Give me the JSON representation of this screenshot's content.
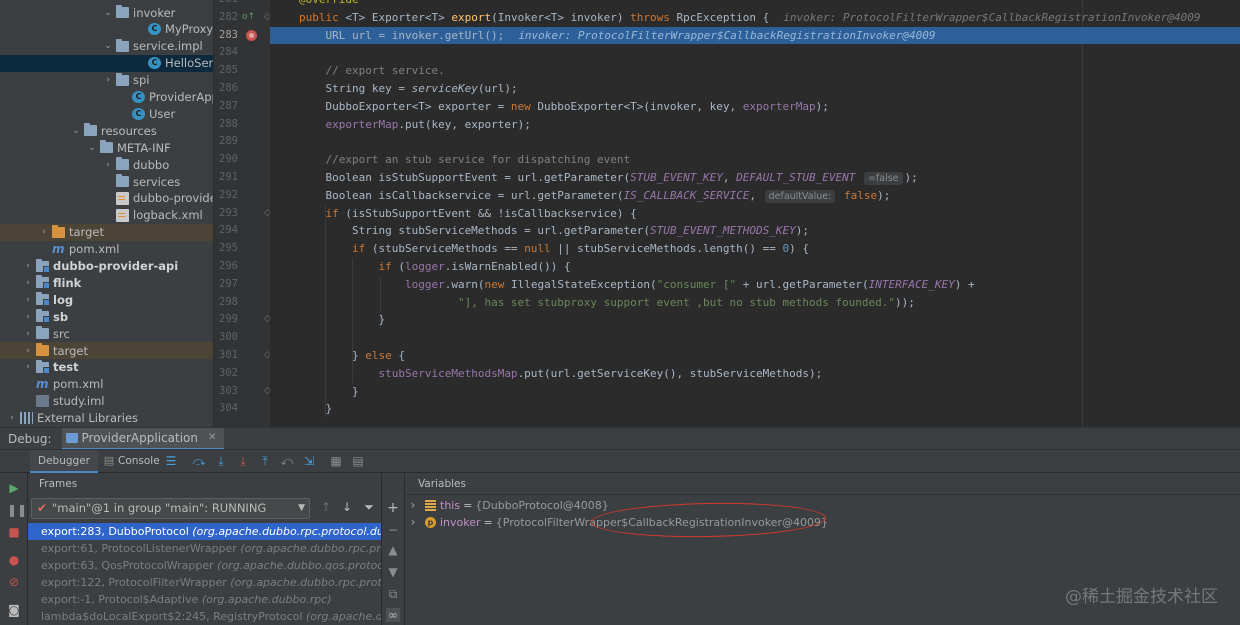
{
  "project_tree": [
    {
      "label": "invoker",
      "icon": "folder",
      "indent": 102,
      "arrow": "▾"
    },
    {
      "label": "MyProxyInvo",
      "icon": "class",
      "indent": 134,
      "arrow": ""
    },
    {
      "label": "service.impl",
      "icon": "folder",
      "indent": 102,
      "arrow": "▾"
    },
    {
      "label": "HelloServiceI",
      "icon": "class",
      "indent": 134,
      "arrow": "",
      "selected": true
    },
    {
      "label": "spi",
      "icon": "folder",
      "indent": 102,
      "arrow": "▸"
    },
    {
      "label": "ProviderApplicat",
      "icon": "class",
      "indent": 118,
      "arrow": ""
    },
    {
      "label": "User",
      "icon": "class",
      "indent": 118,
      "arrow": ""
    },
    {
      "label": "resources",
      "icon": "folder-res",
      "indent": 70,
      "arrow": "▾"
    },
    {
      "label": "META-INF",
      "icon": "folder",
      "indent": 86,
      "arrow": "▾"
    },
    {
      "label": "dubbo",
      "icon": "folder",
      "indent": 102,
      "arrow": "▸"
    },
    {
      "label": "services",
      "icon": "folder",
      "indent": 102,
      "arrow": ""
    },
    {
      "label": "dubbo-provider.xml",
      "icon": "xml",
      "indent": 102,
      "arrow": ""
    },
    {
      "label": "logback.xml",
      "icon": "xml",
      "indent": 102,
      "arrow": ""
    },
    {
      "label": "target",
      "icon": "folder-orange",
      "indent": 38,
      "arrow": "▸",
      "excluded": true
    },
    {
      "label": "pom.xml",
      "icon": "maven",
      "indent": 38,
      "arrow": ""
    },
    {
      "label": "dubbo-provider-api",
      "icon": "module",
      "indent": 22,
      "arrow": "▸",
      "bold": true
    },
    {
      "label": "flink",
      "icon": "module",
      "indent": 22,
      "arrow": "▸",
      "bold": true
    },
    {
      "label": "log",
      "icon": "module",
      "indent": 22,
      "arrow": "▸",
      "bold": true
    },
    {
      "label": "sb",
      "icon": "module",
      "indent": 22,
      "arrow": "▸",
      "bold": true
    },
    {
      "label": "src",
      "icon": "folder",
      "indent": 22,
      "arrow": "▸"
    },
    {
      "label": "target",
      "icon": "folder-orange",
      "indent": 22,
      "arrow": "▸",
      "excluded": true
    },
    {
      "label": "test",
      "icon": "module",
      "indent": 22,
      "arrow": "▸",
      "bold": true
    },
    {
      "label": "pom.xml",
      "icon": "maven",
      "indent": 22,
      "arrow": ""
    },
    {
      "label": "study.iml",
      "icon": "iml",
      "indent": 22,
      "arrow": ""
    },
    {
      "label": "External Libraries",
      "icon": "library",
      "indent": 6,
      "arrow": "▸"
    }
  ],
  "editor": {
    "lines": [
      {
        "n": "281",
        "html": "<span class=\"ann\">@Override</span>"
      },
      {
        "n": "282",
        "html": "<span class=\"kw\">public</span> &lt;T&gt; Exporter&lt;T&gt; <span class=\"fn\">export</span>(Invoker&lt;T&gt; invoker) <span class=\"kw\">throws</span> RpcException {<span class=\"inl\">invoker: ProtocolFilterWrapper$CallbackRegistrationInvoker@4009</span>"
      },
      {
        "n": "283",
        "html": "    URL url = invoker.getUrl();<span class=\"inl\">invoker: ProtocolFilterWrapper$CallbackRegistrationInvoker@4009</span>",
        "exec": true
      },
      {
        "n": "284",
        "html": ""
      },
      {
        "n": "285",
        "html": "    <span class=\"cm\">// export service.</span>"
      },
      {
        "n": "286",
        "html": "    String key = <span class=\"it\">serviceKey</span>(url);"
      },
      {
        "n": "287",
        "html": "    DubboExporter&lt;T&gt; exporter = <span class=\"kw\">new</span> DubboExporter&lt;T&gt;(invoker, key, <span class=\"fld\">exporterMap</span>);"
      },
      {
        "n": "288",
        "html": "    <span class=\"fld\">exporterMap</span>.put(key, exporter);"
      },
      {
        "n": "289",
        "html": ""
      },
      {
        "n": "290",
        "html": "    <span class=\"cm\">//export an stub service for dispatching event</span>"
      },
      {
        "n": "291",
        "html": "    Boolean isStubSupportEvent = url.getParameter(<span class=\"cst\">STUB_EVENT_KEY</span>, <span class=\"cst\">DEFAULT_STUB_EVENT</span> <span class=\"hint\">=false</span>);"
      },
      {
        "n": "292",
        "html": "    Boolean isCallbackservice = url.getParameter(<span class=\"cst\">IS_CALLBACK_SERVICE</span>, <span class=\"hint\">defaultValue:</span> <span class=\"kw\">false</span>);"
      },
      {
        "n": "293",
        "html": "    <span class=\"kw\">if</span> (isStubSupportEvent &amp;&amp; !isCallbackservice) {"
      },
      {
        "n": "294",
        "html": "        String stubServiceMethods = url.getParameter(<span class=\"cst\">STUB_EVENT_METHODS_KEY</span>);"
      },
      {
        "n": "295",
        "html": "        <span class=\"kw\">if</span> (stubServiceMethods == <span class=\"kw\">null</span> || stubServiceMethods.length() == <span class=\"num\">0</span>) {"
      },
      {
        "n": "296",
        "html": "            <span class=\"kw\">if</span> (<span class=\"fld\">logger</span>.isWarnEnabled()) {"
      },
      {
        "n": "297",
        "html": "                <span class=\"fld\">logger</span>.warn(<span class=\"kw\">new</span> IllegalStateException(<span class=\"str\">\"consumer [\"</span> + url.getParameter(<span class=\"cst\">INTERFACE_KEY</span>) +"
      },
      {
        "n": "298",
        "html": "                        <span class=\"str\">\"], has set stubproxy support event ,but no stub methods founded.\"</span>));"
      },
      {
        "n": "299",
        "html": "            }"
      },
      {
        "n": "300",
        "html": ""
      },
      {
        "n": "301",
        "html": "        } <span class=\"kw\">else</span> {"
      },
      {
        "n": "302",
        "html": "            <span class=\"fld\">stubServiceMethodsMap</span>.put(url.getServiceKey(), stubServiceMethods);"
      },
      {
        "n": "303",
        "html": "        }"
      },
      {
        "n": "304",
        "html": "    }"
      }
    ]
  },
  "debug": {
    "label": "Debug:",
    "tab": "ProviderApplication",
    "debugger_tab": "Debugger",
    "console_tab": "Console",
    "frames_header": "Frames",
    "variables_header": "Variables",
    "thread": "\"main\"@1 in group \"main\": RUNNING",
    "frames": [
      {
        "method": "export:283, DubboProtocol",
        "pkg": "(org.apache.dubbo.rpc.protocol.dubbo)",
        "selected": true
      },
      {
        "method": "export:61, ProtocolListenerWrapper",
        "pkg": "(org.apache.dubbo.rpc.protocol)"
      },
      {
        "method": "export:63, QosProtocolWrapper",
        "pkg": "(org.apache.dubbo.qos.protocol)"
      },
      {
        "method": "export:122, ProtocolFilterWrapper",
        "pkg": "(org.apache.dubbo.rpc.protocol)"
      },
      {
        "method": "export:-1, Protocol$Adaptive",
        "pkg": "(org.apache.dubbo.rpc)"
      },
      {
        "method": "lambda$doLocalExport$2:245, RegistryProtocol",
        "pkg": "(org.apache.dubbo.r"
      }
    ],
    "variables": [
      {
        "name": "this",
        "value": "{DubboProtocol@4008}",
        "icon": "field"
      },
      {
        "name": "invoker",
        "value": "{ProtocolFilterWrapper$CallbackRegistrationInvoker@4009}",
        "icon": "param"
      }
    ]
  },
  "watermark": "@稀土掘金技术社区"
}
